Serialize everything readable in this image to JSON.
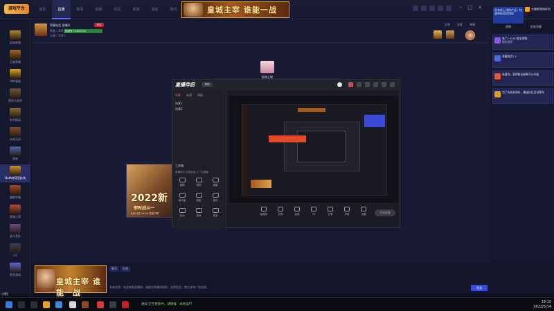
{
  "app": {
    "logo": "游戏平台"
  },
  "nav": [
    "首页",
    "直播",
    "赛事",
    "视频",
    "社区",
    "商城",
    "活动",
    "我的",
    "更多"
  ],
  "nav_active": 1,
  "banner_text": "皇城主宰 谁能一战",
  "promo": {
    "left_text": "您有新上线的产品，快速审核游戏特权",
    "right_text": "大量新游戏好玩",
    "btn_left": "消息",
    "btn_right": "好友列表"
  },
  "sidebar": [
    {
      "label": "英雄联盟",
      "color": "#b08a3a"
    },
    {
      "label": "王者荣耀",
      "color": "#9b6b2a"
    },
    {
      "label": "DNF超级",
      "color": "#d9a520"
    },
    {
      "label": "绝地大逃杀",
      "color": "#6e5a3a"
    },
    {
      "label": "和平精英",
      "color": "#8a6b3c"
    },
    {
      "label": "永劫无间",
      "color": "#7c4b2e"
    },
    {
      "label": "原神",
      "color": "#4a6bb5"
    },
    {
      "label": "DotA传奇竞技场",
      "color": "#c9942c"
    },
    {
      "label": "魔兽争霸",
      "color": "#a04b2a"
    },
    {
      "label": "英雄三国",
      "color": "#b5493a"
    },
    {
      "label": "战斗竞技",
      "color": "#6a4a8a"
    },
    {
      "label": "CS",
      "color": "#3a3d5a"
    },
    {
      "label": "更多游戏",
      "color": "#5a6bd8"
    }
  ],
  "sidebar_active": 7,
  "room": {
    "title": "荣耀电竞 直播间",
    "tag": "频道号 23862000",
    "tag2": "关注",
    "sub": "热度 : 1041",
    "sub2": "主播 : 1041",
    "right1": "分享",
    "right2": "全屏",
    "right3": "弹幕"
  },
  "stage": {
    "badge_label": "耐神之眼",
    "ad_year": "2022新",
    "ad_line": "即时战斗一",
    "ad_foot": "5月14日 14:00 开放下载"
  },
  "tool": {
    "logo": "直播伴侣",
    "badge": "帮助",
    "tabs": [
      "场景",
      "来源",
      "高级"
    ],
    "scenes": [
      "场景1",
      "场景2"
    ],
    "section": "工具箱",
    "sub": "直播助手   礼物答谢   上一次直播",
    "grid": [
      "美颜",
      "滤镜",
      "弹幕",
      "画中画",
      "贴纸",
      "音乐",
      "互动",
      "游戏",
      "更多"
    ],
    "bottom": [
      "直播间",
      "礼物",
      "连麦",
      "PK",
      "分享",
      "声音",
      "设置"
    ],
    "start": "开始直播"
  },
  "right_cards": [
    {
      "title": "来了1 8.40 版本攻略",
      "sub": "精彩推荐",
      "color": "#8a5bd8"
    },
    {
      "title": "荣耀电竞1 2",
      "sub": "",
      "color": "#4a6bd8"
    },
    {
      "title": "恭喜你，获得粉丝勋章可以升级",
      "sub": "",
      "color": "#d85a3a"
    },
    {
      "title": "为了庆祝本周年，赠送好礼活动等你",
      "sub": "",
      "color": "#d8a03a"
    }
  ],
  "bottom": {
    "banner_text": "皇城主宰 谁能一战",
    "chat_tabs": [
      "聊天",
      "礼物"
    ],
    "chat_line": "系统消息：欢迎来到直播间，请遵守直播间规则，文明发言，禁止发布广告信息。",
    "send": "发送"
  },
  "taskbar": {
    "status": "通知 正在更新中，请稍候 · 本地运行",
    "time": "19:12",
    "date": "2022/5/14",
    "user": "小明"
  }
}
